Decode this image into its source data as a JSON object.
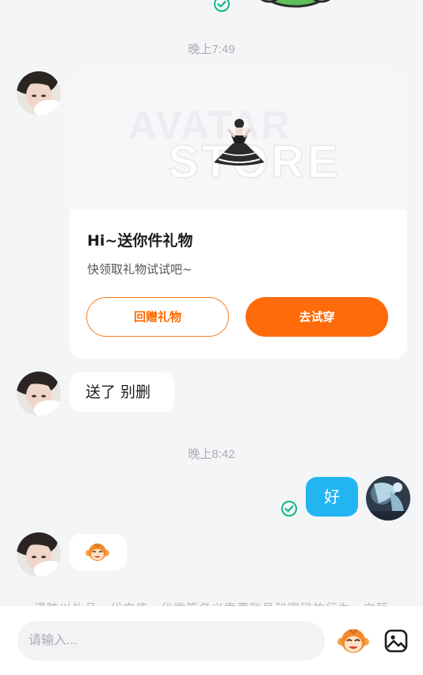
{
  "chat": {
    "timestamps": [
      "晚上7:49",
      "晚上8:42"
    ],
    "gift_card": {
      "banner_text_1": "AVATAR",
      "banner_text_2": "STORE",
      "title": "Hi~送你件礼物",
      "subtitle": "快领取礼物试试吧~",
      "return_gift_label": "回赠礼物",
      "try_on_label": "去试穿"
    },
    "messages": {
      "other_text": "送了 别删",
      "my_text": "好"
    },
    "faded_notice": "谨防以礼品、代充值、代缴等名义索要账号和密码的行为，向陌"
  },
  "input_bar": {
    "placeholder": "请输入...",
    "emoji_icon": "monkey-emoji-icon",
    "image_icon": "image-icon"
  },
  "colors": {
    "accent_orange": "#ff6a0a",
    "my_bubble": "#23b5f2",
    "read_check": "#12b886",
    "background": "#f4f5f7"
  }
}
